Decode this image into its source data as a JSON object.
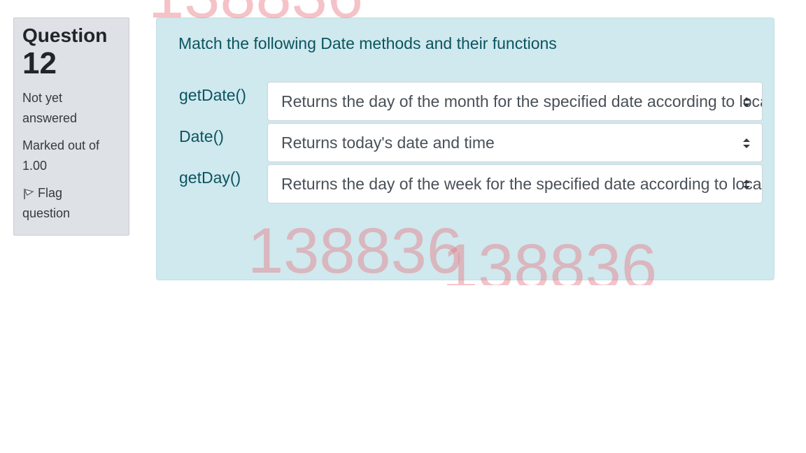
{
  "question": {
    "label": "Question",
    "number": "12",
    "state": "Not yet answered",
    "grade": "Marked out of 1.00",
    "flag_label": "Flag question"
  },
  "content": {
    "text": "Match the following Date methods and their functions",
    "rows": [
      {
        "label": "getDate()",
        "selected": "Returns the day of the month for the specified date according to local time"
      },
      {
        "label": "Date()",
        "selected": "Returns today's date and time"
      },
      {
        "label": "getDay()",
        "selected": "Returns the day of the week for the specified date according to local time"
      }
    ]
  },
  "watermarks": [
    "138836",
    "138836",
    "138836"
  ],
  "colors": {
    "info_bg": "#dee2e6",
    "content_bg": "#cfe9ee",
    "content_text": "#0c5460",
    "watermark": "#e67882"
  },
  "icons": {
    "flag": "flag-icon",
    "select_arrows": "chevron-updown-icon"
  }
}
